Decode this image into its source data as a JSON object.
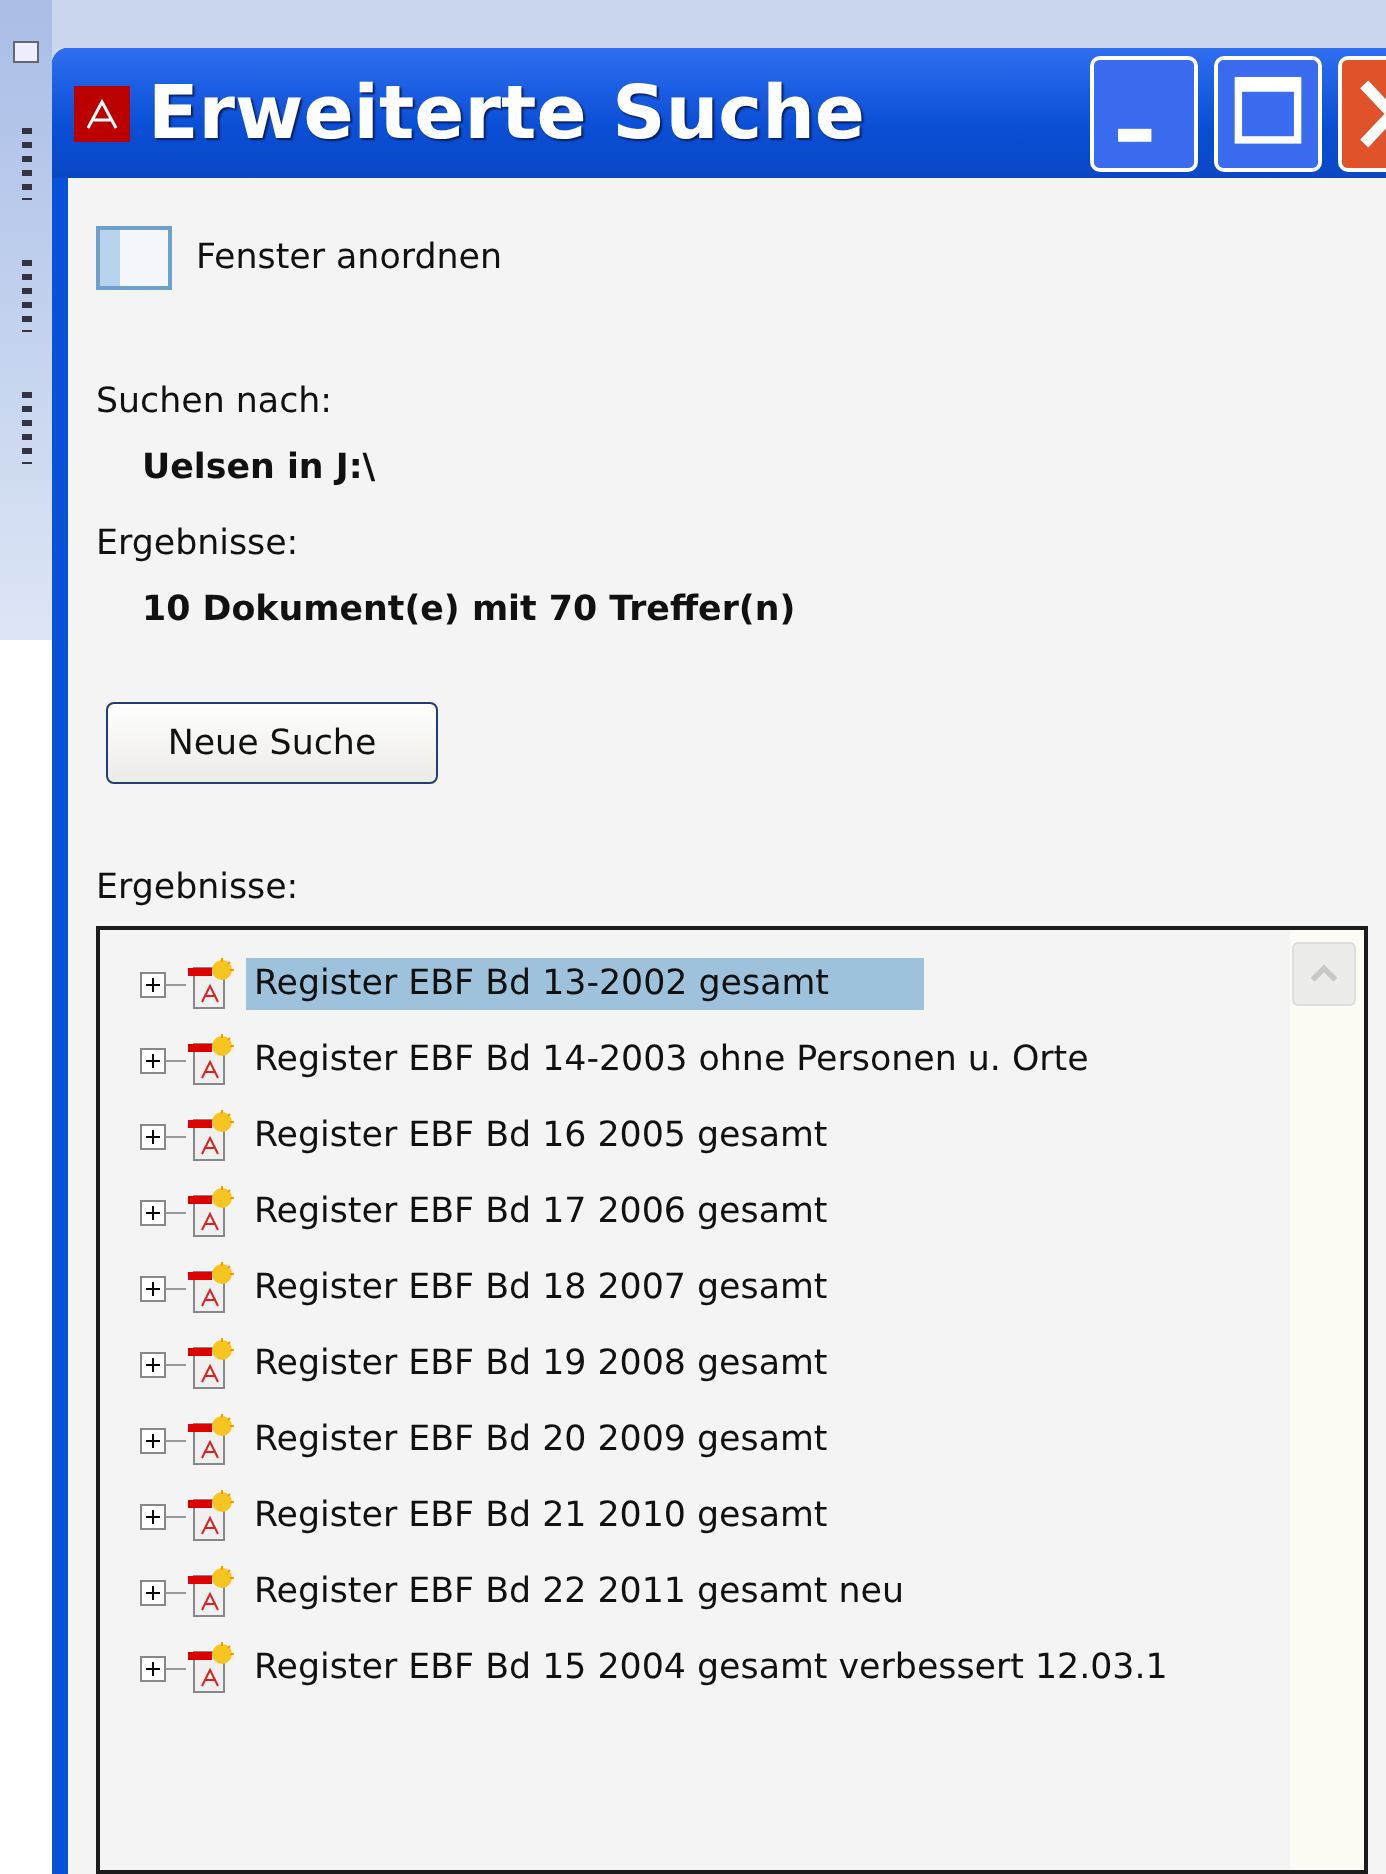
{
  "window": {
    "title": "Erweiterte Suche"
  },
  "arrange_link": {
    "label": "Fenster anordnen"
  },
  "search_for": {
    "label": "Suchen nach:",
    "value": "Uelsen in J:\\"
  },
  "summary": {
    "label": "Ergebnisse:",
    "value": "10 Dokument(e) mit 70 Treffer(n)"
  },
  "new_search_button": {
    "label": "Neue Suche"
  },
  "results": {
    "label": "Ergebnisse:",
    "items": [
      {
        "label": "Register EBF Bd 13-2002 gesamt",
        "selected": true,
        "expanded": false
      },
      {
        "label": "Register EBF Bd 14-2003 ohne Personen u. Orte",
        "selected": false,
        "expanded": false
      },
      {
        "label": "Register EBF Bd 16 2005 gesamt",
        "selected": false,
        "expanded": false
      },
      {
        "label": "Register EBF Bd 17 2006 gesamt",
        "selected": false,
        "expanded": false
      },
      {
        "label": "Register EBF Bd 18 2007 gesamt",
        "selected": false,
        "expanded": false
      },
      {
        "label": "Register EBF Bd 19 2008 gesamt",
        "selected": false,
        "expanded": false
      },
      {
        "label": "Register EBF Bd 20 2009 gesamt",
        "selected": false,
        "expanded": false
      },
      {
        "label": "Register EBF Bd 21 2010 gesamt",
        "selected": false,
        "expanded": false
      },
      {
        "label": "Register EBF Bd 22 2011 gesamt neu",
        "selected": false,
        "expanded": false
      },
      {
        "label": "Register EBF Bd 15 2004 gesamt verbessert 12.03.1",
        "selected": false,
        "expanded": false
      }
    ]
  }
}
